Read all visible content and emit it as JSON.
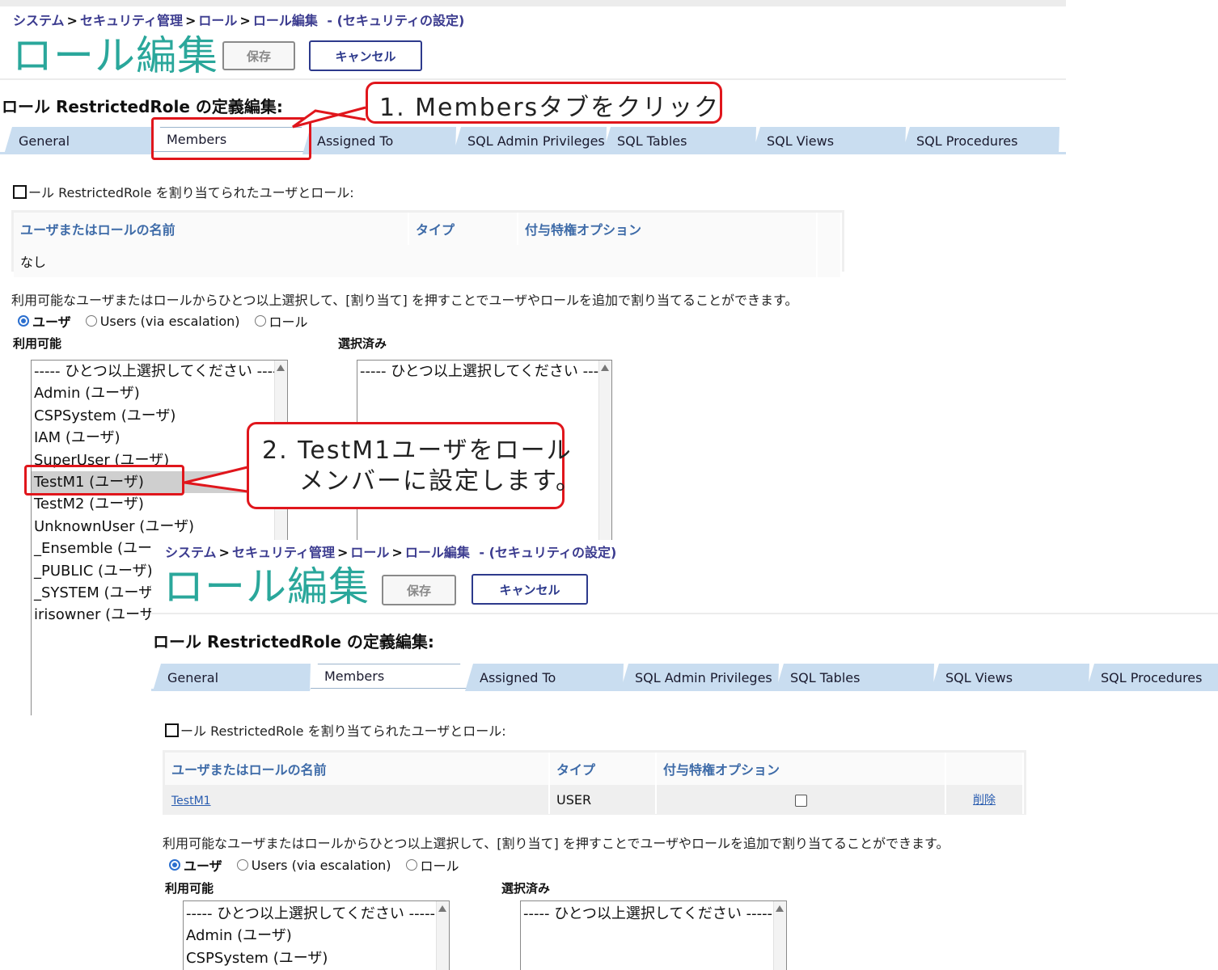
{
  "screen_a": {
    "breadcrumb": {
      "items": [
        "システム",
        "セキュリティ管理",
        "ロール",
        "ロール編集"
      ],
      "suffix": "- (セキュリティの設定)"
    },
    "page_title": "ロール編集",
    "save_label": "保存",
    "cancel_label": "キャンセル",
    "section_title": "ロール RestrictedRole の定義編集:",
    "tabs": [
      "General",
      "Members",
      "Assigned To",
      "SQL Admin Privileges",
      "SQL Tables",
      "SQL Views",
      "SQL Procedures"
    ],
    "selected_tab": "Members",
    "members_caption": "ール RestrictedRole を割り当てられたユーザとロール:",
    "table": {
      "headers": [
        "ユーザまたはロールの名前",
        "タイプ",
        "付与特権オプション"
      ],
      "empty": "なし"
    },
    "info_text": "利用可能なユーザまたはロールからひとつ以上選択して、[割り当て] を押すことでユーザやロールを追加で割り当てることができます。",
    "radios": [
      "ユーザ",
      "Users (via escalation)",
      "ロール"
    ],
    "available_label": "利用可能",
    "selected_label": "選択済み",
    "available_options": [
      "----- ひとつ以上選択してください -----",
      "Admin (ユーザ)",
      "CSPSystem (ユーザ)",
      "IAM (ユーザ)",
      "SuperUser (ユーザ)",
      "TestM1 (ユーザ)",
      "TestM2 (ユーザ)",
      "UnknownUser (ユーザ)",
      "_Ensemble (ユーザ)",
      "_PUBLIC (ユーザ)",
      "_SYSTEM (ユーザ)",
      "irisowner (ユーザ)"
    ],
    "highlighted_option": "TestM1 (ユーザ)",
    "selected_options": [
      "----- ひとつ以上選択してください -----"
    ]
  },
  "screen_b": {
    "breadcrumb": {
      "items": [
        "システム",
        "セキュリティ管理",
        "ロール",
        "ロール編集"
      ],
      "suffix": "- (セキュリティの設定)"
    },
    "page_title": "ロール編集",
    "save_label": "保存",
    "cancel_label": "キャンセル",
    "section_title": "ロール RestrictedRole の定義編集:",
    "tabs": [
      "General",
      "Members",
      "Assigned To",
      "SQL Admin Privileges",
      "SQL Tables",
      "SQL Views",
      "SQL Procedures"
    ],
    "members_caption": "ール RestrictedRole を割り当てられたユーザとロール:",
    "table": {
      "headers": [
        "ユーザまたはロールの名前",
        "タイプ",
        "付与特権オプション"
      ],
      "rows": [
        {
          "name": "TestM1",
          "type": "USER",
          "delete": "削除"
        }
      ]
    },
    "info_text": "利用可能なユーザまたはロールからひとつ以上選択して、[割り当て] を押すことでユーザやロールを追加で割り当てることができます。",
    "radios": [
      "ユーザ",
      "Users (via escalation)",
      "ロール"
    ],
    "available_label": "利用可能",
    "selected_label": "選択済み",
    "available_options": [
      "----- ひとつ以上選択してください -----",
      "Admin (ユーザ)",
      "CSPSystem (ユーザ)"
    ],
    "selected_options": [
      "----- ひとつ以上選択してください -----"
    ]
  },
  "callouts": {
    "step1": "1.  Membersタブをクリック",
    "step2_line1": "2.  TestM1ユーザをロール",
    "step2_line2": "メンバーに設定します。"
  },
  "colors": {
    "title": "#2aa79b",
    "tab": "#c9ddf0",
    "callout": "#e0161c",
    "link": "#3e6ba8"
  }
}
